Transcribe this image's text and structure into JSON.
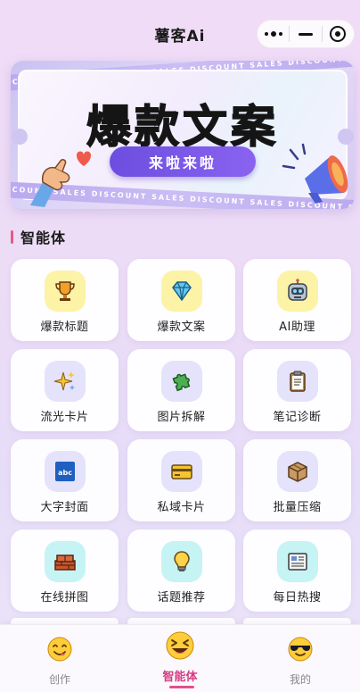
{
  "app": {
    "title": "薯客Ai"
  },
  "banner": {
    "title": "爆款文案",
    "button_label": "来啦来啦",
    "stripe_text": "DISCOUNT SALES   DISCOUNT SALES   DISCOUNT SALES   DISCOUNT SALES"
  },
  "section": {
    "title": "智能体"
  },
  "tools": [
    {
      "label": "爆款标题",
      "icon": "trophy-icon"
    },
    {
      "label": "爆款文案",
      "icon": "gem-icon"
    },
    {
      "label": "AI助理",
      "icon": "robot-icon"
    },
    {
      "label": "流光卡片",
      "icon": "sparkles-icon"
    },
    {
      "label": "图片拆解",
      "icon": "puzzle-icon"
    },
    {
      "label": "笔记诊断",
      "icon": "clipboard-icon"
    },
    {
      "label": "大字封面",
      "icon": "abc-icon"
    },
    {
      "label": "私域卡片",
      "icon": "credit-card-icon"
    },
    {
      "label": "批量压缩",
      "icon": "package-icon"
    },
    {
      "label": "在线拼图",
      "icon": "bricks-icon"
    },
    {
      "label": "话题推荐",
      "icon": "lightbulb-icon"
    },
    {
      "label": "每日热搜",
      "icon": "newspaper-icon"
    }
  ],
  "tabbar": {
    "items": [
      {
        "label": "创作",
        "icon": "savoring-face-icon"
      },
      {
        "label": "智能体",
        "icon": "grinning-squint-face-icon",
        "active": true
      },
      {
        "label": "我的",
        "icon": "sunglasses-face-icon"
      }
    ]
  },
  "colors": {
    "accent": "#d63d82",
    "banner_button": "#7356e6",
    "background": "#ecdcf6"
  }
}
